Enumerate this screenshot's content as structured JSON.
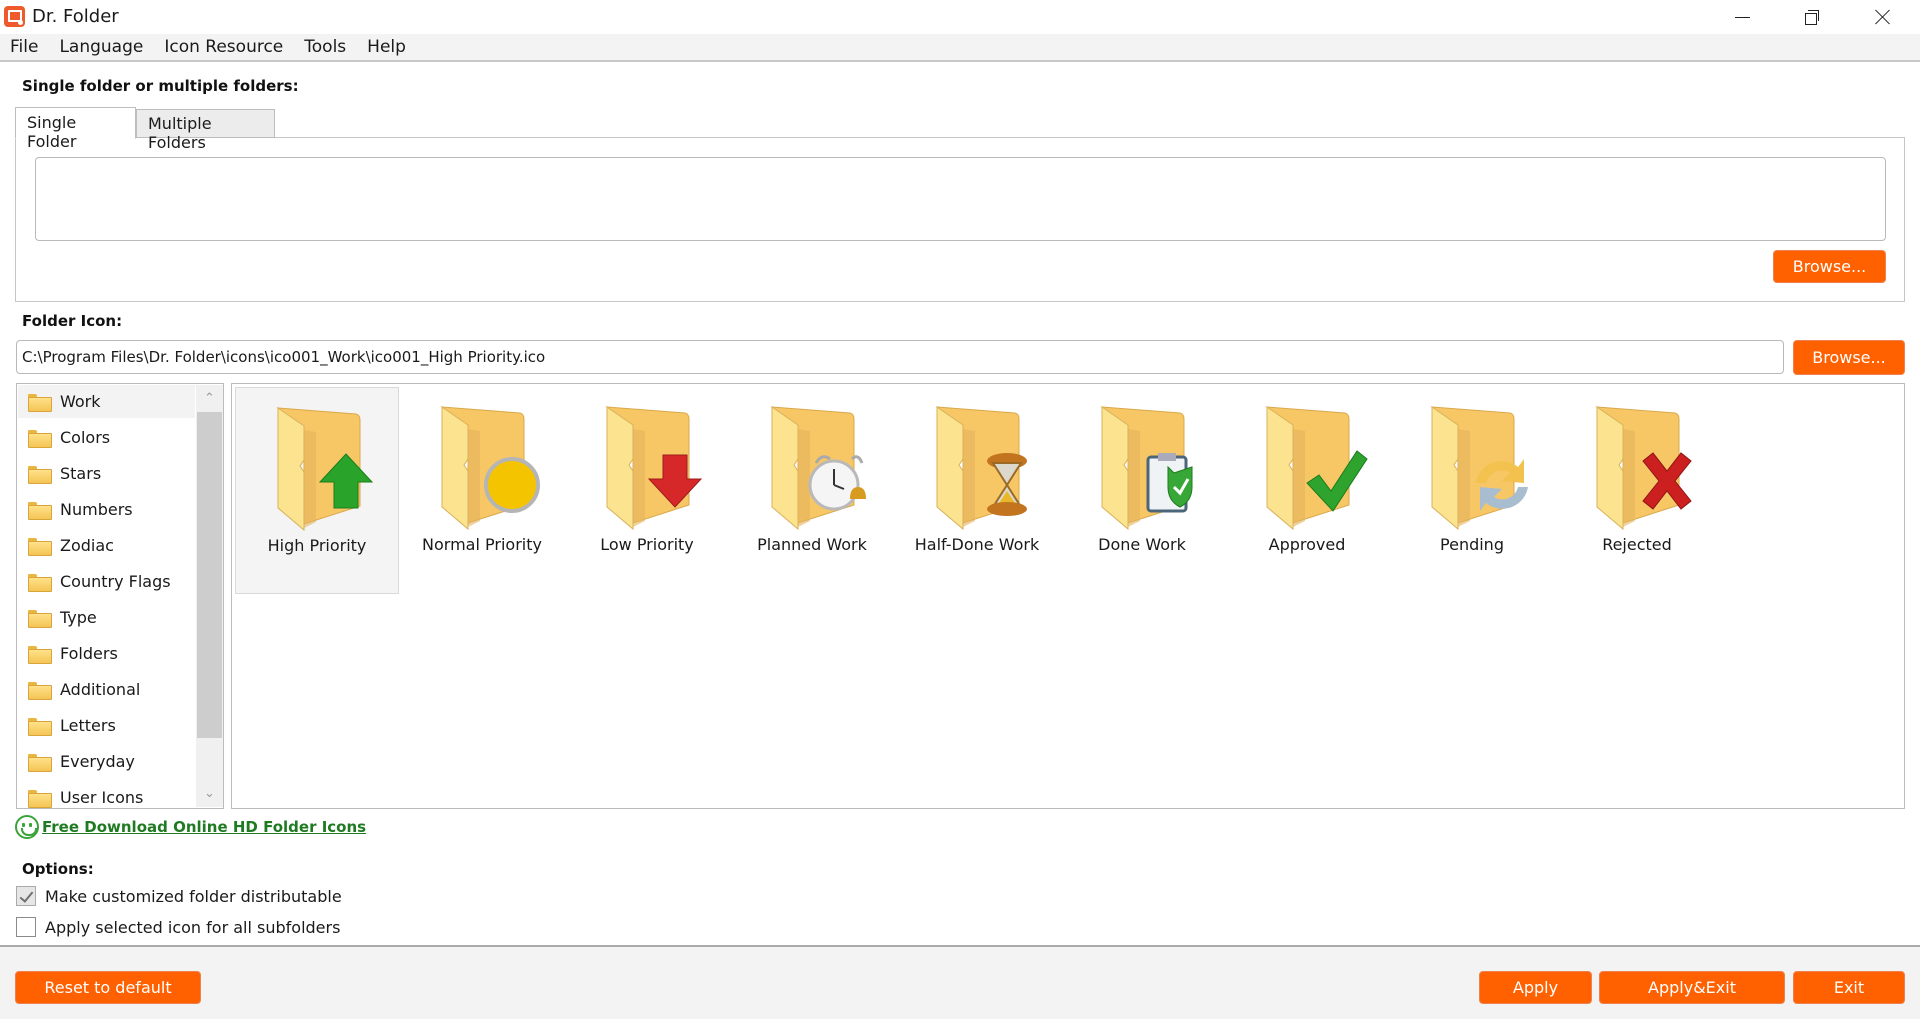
{
  "window": {
    "title": "Dr. Folder",
    "controls": {
      "minimize": "minimize",
      "maximize": "restore",
      "close": "close"
    }
  },
  "menu": [
    "File",
    "Language",
    "Icon Resource",
    "Tools",
    "Help"
  ],
  "folder_section": {
    "label": "Single folder or multiple folders:",
    "tabs": [
      {
        "label": "Single Folder",
        "active": true
      },
      {
        "label": "Multiple Folders",
        "active": false
      }
    ],
    "folder_path_value": "",
    "browse_label": "Browse..."
  },
  "icon_section": {
    "label": "Folder Icon:",
    "path_value": "C:\\Program Files\\Dr. Folder\\icons\\ico001_Work\\ico001_High Priority.ico",
    "browse_label": "Browse..."
  },
  "categories": {
    "selected": "Work",
    "items": [
      "Work",
      "Colors",
      "Stars",
      "Numbers",
      "Zodiac",
      "Country Flags",
      "Type",
      "Folders",
      "Additional",
      "Letters",
      "Everyday",
      "User Icons"
    ]
  },
  "icons": {
    "selected": "High Priority",
    "items": [
      {
        "label": "High Priority",
        "badge": "up-arrow",
        "color": "#2aa32a"
      },
      {
        "label": "Normal Priority",
        "badge": "circle",
        "color": "#f5c400"
      },
      {
        "label": "Low Priority",
        "badge": "down-arrow",
        "color": "#d62828"
      },
      {
        "label": "Planned Work",
        "badge": "alarm-clock",
        "color": "#dcdcdc"
      },
      {
        "label": "Half-Done Work",
        "badge": "hourglass",
        "color": "#c2741f"
      },
      {
        "label": "Done Work",
        "badge": "clipboard-shield",
        "color": "#37a837"
      },
      {
        "label": "Approved",
        "badge": "checkmark",
        "color": "#2ea32e"
      },
      {
        "label": "Pending",
        "badge": "refresh",
        "color": "#f2c14e"
      },
      {
        "label": "Rejected",
        "badge": "x-mark",
        "color": "#cc1f1f"
      }
    ]
  },
  "download_link": "Free Download Online HD Folder Icons",
  "options": {
    "label": "Options:",
    "items": [
      {
        "label": "Make customized folder distributable",
        "checked": true
      },
      {
        "label": "Apply selected icon for all subfolders",
        "checked": false
      }
    ]
  },
  "footer": {
    "reset": "Reset to default",
    "apply": "Apply",
    "apply_exit": "Apply&Exit",
    "exit": "Exit"
  },
  "colors": {
    "accent": "#ff6000",
    "link": "#1f7a22"
  }
}
